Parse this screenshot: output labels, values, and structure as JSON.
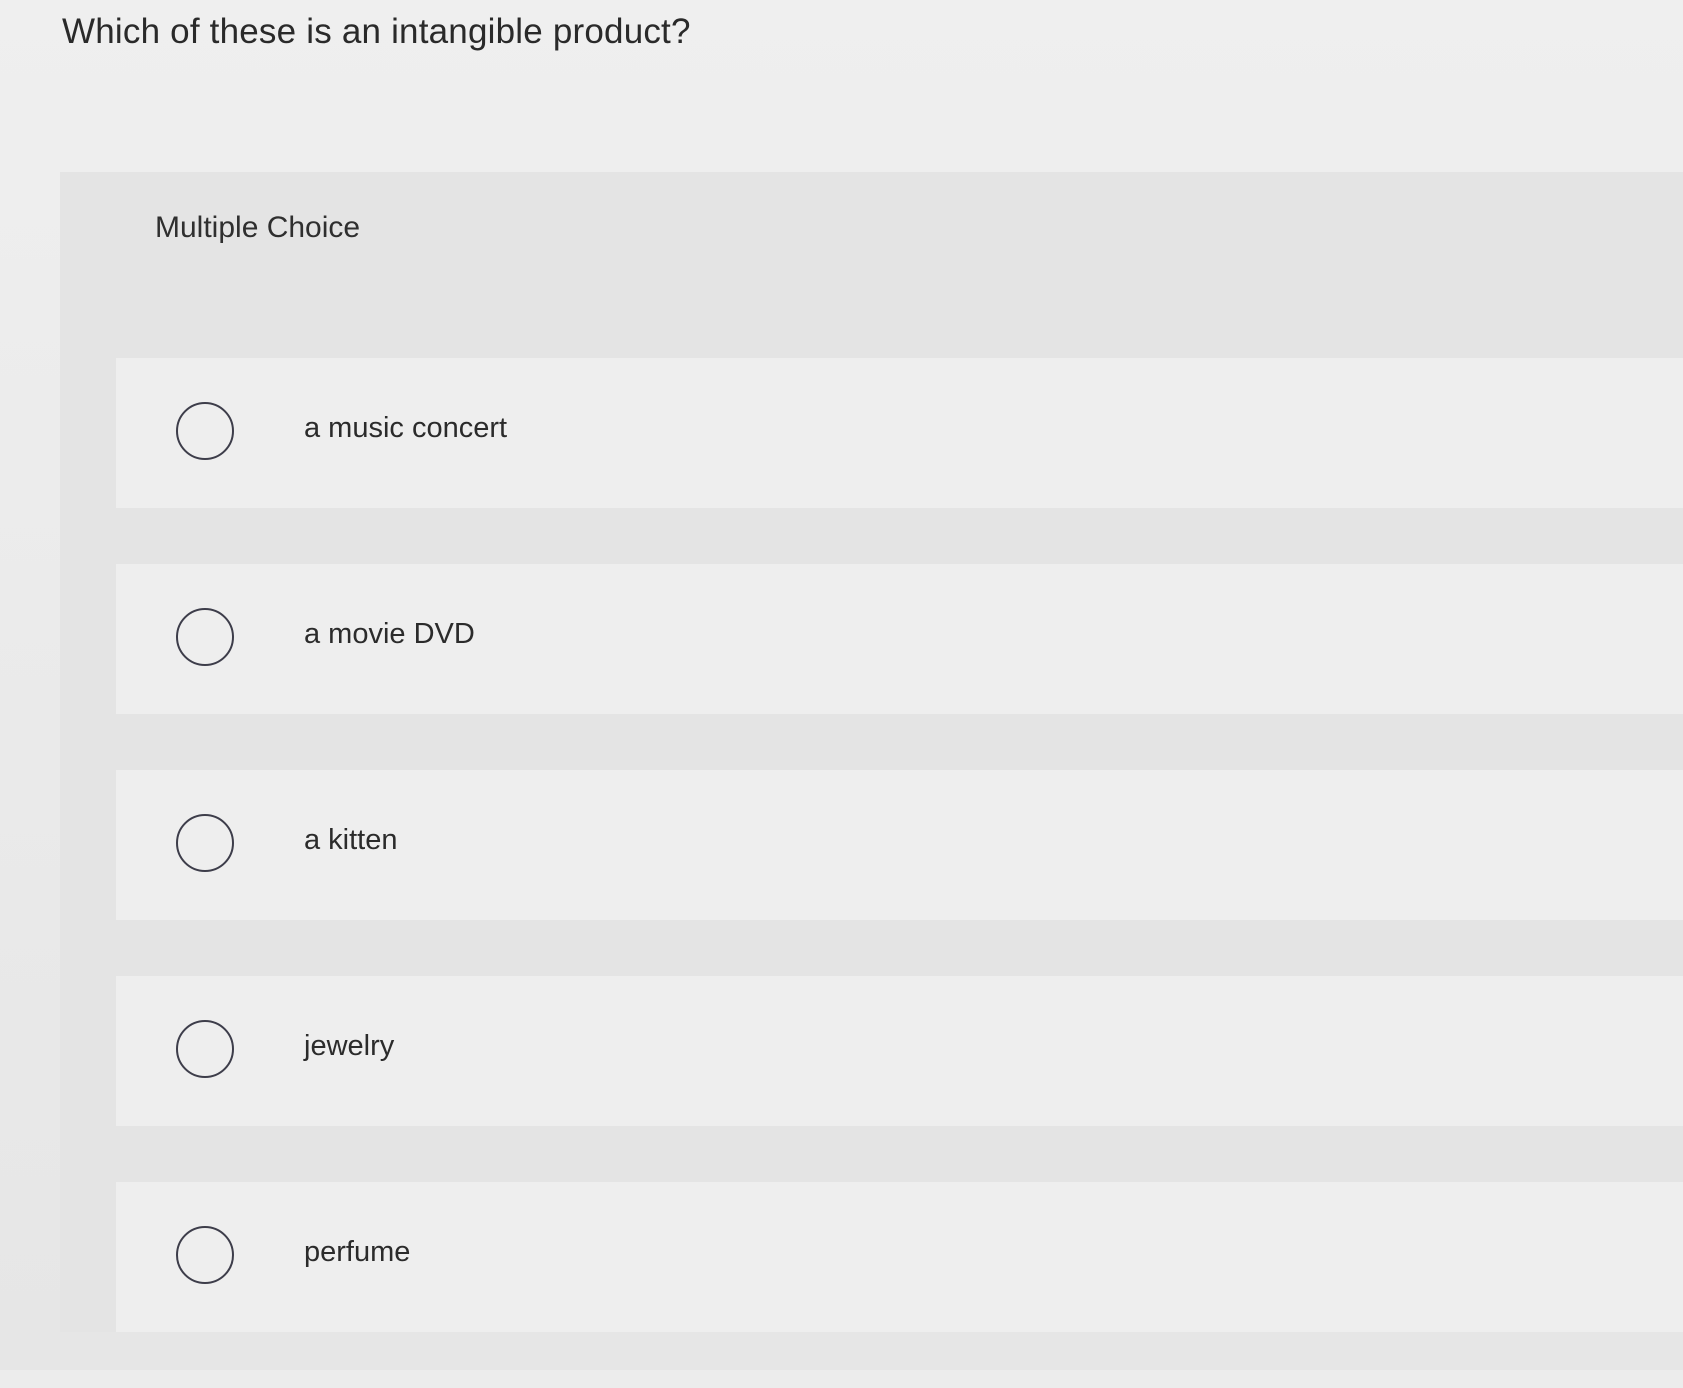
{
  "question": {
    "text": "Which of these is an intangible product?"
  },
  "multiple_choice": {
    "label": "Multiple Choice",
    "options": [
      {
        "label": "a music concert",
        "selected": false
      },
      {
        "label": "a movie DVD",
        "selected": false
      },
      {
        "label": "a kitten",
        "selected": false
      },
      {
        "label": "jewelry",
        "selected": false
      },
      {
        "label": "perfume",
        "selected": false
      }
    ]
  },
  "colors": {
    "background": "#ececec",
    "panel": "#e4e4e4",
    "option_row": "#eeeeee",
    "text": "#2b2b2b",
    "radio_border": "#3d3d4a"
  },
  "icons": {
    "radio": "radio-circle-empty-icon"
  }
}
